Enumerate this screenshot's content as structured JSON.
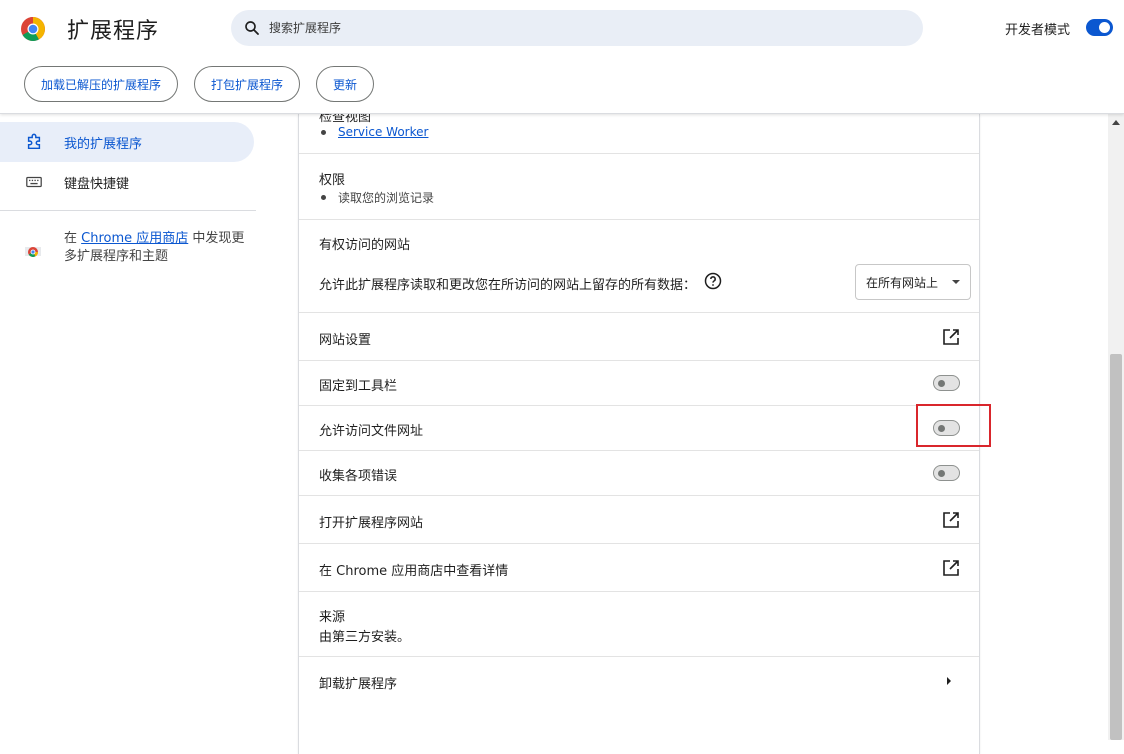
{
  "header": {
    "title": "扩展程序",
    "search_placeholder": "搜索扩展程序",
    "dev_mode_label": "开发者模式",
    "dev_mode_on": true,
    "buttons": [
      "加载已解压的扩展程序",
      "打包扩展程序",
      "更新"
    ]
  },
  "sidebar": {
    "items": [
      {
        "label": "我的扩展程序",
        "icon": "extension-icon",
        "active": true
      },
      {
        "label": "键盘快捷键",
        "icon": "keyboard-icon",
        "active": false
      }
    ],
    "store_promo": {
      "prefix": "在 ",
      "link": "Chrome 应用商店",
      "suffix": " 中发现更多扩展程序和主题"
    }
  },
  "details": {
    "inspect_views_label": "检查视图",
    "inspect_views_link": "Service Worker",
    "permissions_label": "权限",
    "permissions_item": "读取您的浏览记录",
    "site_access_label": "有权访问的网站",
    "site_access_desc": "允许此扩展程序读取和更改您在所访问的网站上留存的所有数据：",
    "site_access_value": "在所有网站上",
    "site_settings": "网站设置",
    "pin_toolbar": "固定到工具栏",
    "pin_toolbar_on": false,
    "file_urls": "允许访问文件网址",
    "file_urls_on": false,
    "collect_errors": "收集各项错误",
    "collect_errors_on": false,
    "open_site": "打开扩展程序网站",
    "view_in_store": "在 Chrome 应用商店中查看详情",
    "source_label": "来源",
    "source_value": "由第三方安装。",
    "remove": "卸载扩展程序"
  },
  "colors": {
    "accent": "#0b57d0",
    "highlight": "#d9262c"
  }
}
